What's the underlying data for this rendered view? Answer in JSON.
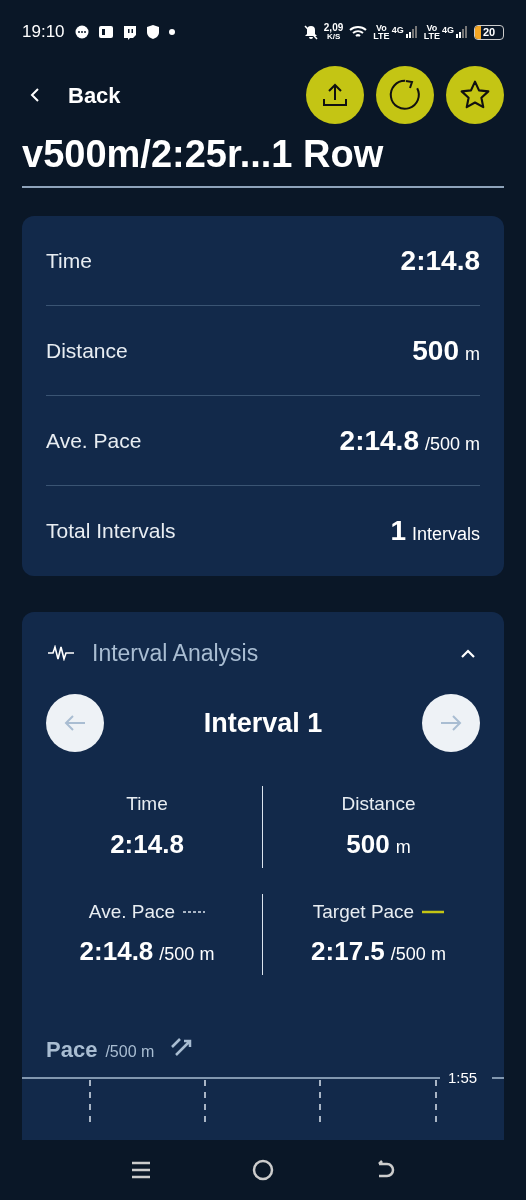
{
  "status_bar": {
    "time": "19:10",
    "speed": "2,09",
    "speed_unit": "K/S",
    "sim1": {
      "volte_top": "Vo",
      "volte_bottom": "LTE",
      "network": "4G"
    },
    "sim2": {
      "volte_top": "Vo",
      "volte_bottom": "LTE",
      "network": "4G"
    },
    "battery": "20"
  },
  "header": {
    "back_label": "Back",
    "title": "v500m/2:25r...1 Row"
  },
  "summary": [
    {
      "label": "Time",
      "value": "2:14.8"
    },
    {
      "label": "Distance",
      "value": "500",
      "unit": "m"
    },
    {
      "label": "Ave. Pace",
      "value": "2:14.8",
      "unit": "/500 m"
    },
    {
      "label": "Total Intervals",
      "value": "1",
      "unit": "Intervals"
    }
  ],
  "interval_analysis": {
    "title": "Interval Analysis",
    "expanded": true,
    "interval_title": "Interval 1",
    "stats": [
      {
        "label": "Time",
        "value": "2:14.8"
      },
      {
        "label": "Distance",
        "value": "500",
        "unit": "m"
      },
      {
        "label": "Ave. Pace",
        "value": "2:14.8",
        "unit": "/500 m",
        "kind": "dashed"
      },
      {
        "label": "Target Pace",
        "value": "2:17.5",
        "unit": "/500 m",
        "kind": "solid"
      }
    ],
    "chart": {
      "title": "Pace",
      "unit": "/500 m",
      "y_label": "1:55"
    }
  }
}
